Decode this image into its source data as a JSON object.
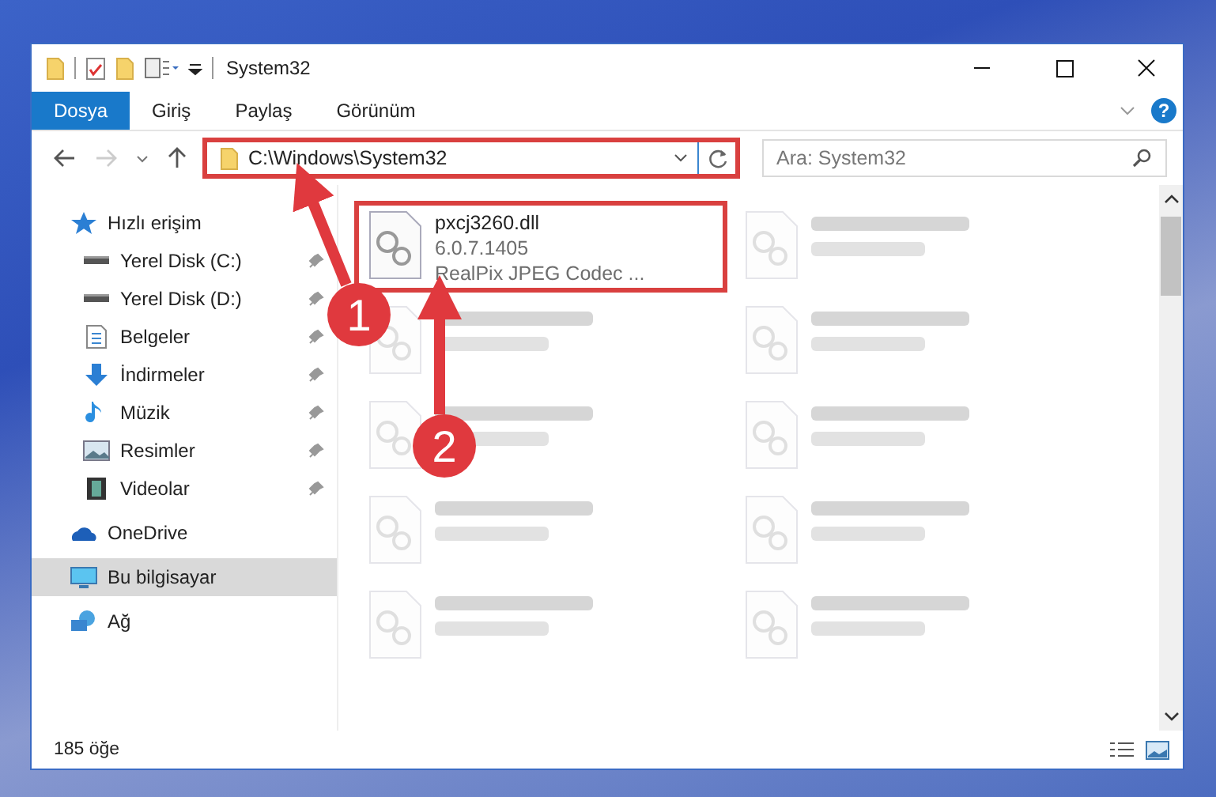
{
  "window": {
    "title": "System32"
  },
  "ribbon_tabs": [
    {
      "label": "Dosya",
      "selected": true
    },
    {
      "label": "Giriş",
      "selected": false
    },
    {
      "label": "Paylaş",
      "selected": false
    },
    {
      "label": "Görünüm",
      "selected": false
    }
  ],
  "help": "?",
  "address": {
    "value": "C:\\Windows\\System32",
    "highlighted": true
  },
  "search": {
    "placeholder": "Ara: System32"
  },
  "sidebar": {
    "items": [
      {
        "label": "Hızlı erişim",
        "kind": "star",
        "selected": false,
        "children": [
          {
            "label": "Yerel Disk (C:)",
            "kind": "drive",
            "pinned": true,
            "selected": false
          },
          {
            "label": "Yerel Disk (D:)",
            "kind": "drive",
            "pinned": true,
            "selected": false
          },
          {
            "label": "Belgeler",
            "kind": "document",
            "pinned": true,
            "selected": false
          },
          {
            "label": "İndirmeler",
            "kind": "download",
            "pinned": true,
            "selected": false
          },
          {
            "label": "Müzik",
            "kind": "music",
            "pinned": true,
            "selected": false
          },
          {
            "label": "Resimler",
            "kind": "image",
            "pinned": true,
            "selected": false
          },
          {
            "label": "Videolar",
            "kind": "video",
            "pinned": true,
            "selected": false
          }
        ]
      },
      {
        "label": "OneDrive",
        "kind": "cloud",
        "selected": false
      },
      {
        "label": "Bu bilgisayar",
        "kind": "computer",
        "selected": true
      },
      {
        "label": "Ağ",
        "kind": "network",
        "selected": false
      }
    ]
  },
  "files": [
    {
      "name": "pxcj3260.dll",
      "lines": [
        "6.0.7.1405",
        "RealPix JPEG Codec ..."
      ],
      "highlighted": true,
      "blurred": false
    },
    {
      "highlighted": false,
      "blurred": true
    },
    {
      "highlighted": false,
      "blurred": true
    },
    {
      "highlighted": false,
      "blurred": true
    },
    {
      "highlighted": false,
      "blurred": true
    },
    {
      "highlighted": false,
      "blurred": true
    },
    {
      "highlighted": false,
      "blurred": true
    },
    {
      "highlighted": false,
      "blurred": true
    },
    {
      "highlighted": false,
      "blurred": true
    },
    {
      "highlighted": false,
      "blurred": true
    }
  ],
  "status_bar": {
    "count": "185 öğe"
  },
  "annotations": [
    {
      "number": "1"
    },
    {
      "number": "2"
    }
  ]
}
